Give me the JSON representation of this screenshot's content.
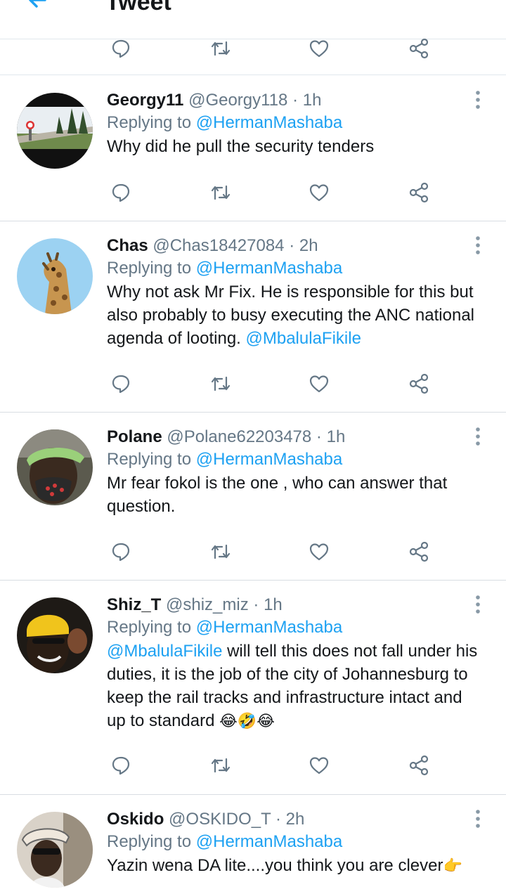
{
  "header": {
    "title": "Tweet"
  },
  "tweets": [
    {
      "name": "Georgy11",
      "handle": "@Georgy118",
      "time": "1h",
      "reply_prefix": "Replying to",
      "reply_to": "@HermanMashaba",
      "text": "Why did he pull the security tenders"
    },
    {
      "name": "Chas",
      "handle": "@Chas18427084",
      "time": "2h",
      "reply_prefix": "Replying to",
      "reply_to": "@HermanMashaba",
      "text": "Why not ask Mr Fix. He is responsible for this but also probably to busy executing the ANC national agenda of looting.",
      "mention": "@MbalulaFikile"
    },
    {
      "name": "Polane",
      "handle": "@Polane62203478",
      "time": "1h",
      "reply_prefix": "Replying to",
      "reply_to": "@HermanMashaba",
      "text": "Mr fear fokol is the one , who can answer that question."
    },
    {
      "name": "Shiz_T",
      "handle": "@shiz_miz",
      "time": "1h",
      "reply_prefix": "Replying to",
      "reply_to": "@HermanMashaba",
      "mention": "@MbalulaFikile",
      "text": "will tell this does not fall under his duties, it is the job of the city of Johannesburg to keep the rail tracks and infrastructure intact and up to standard",
      "emoji": "😂🤣😂"
    },
    {
      "name": "Oskido",
      "handle": "@OSKIDO_T",
      "time": "2h",
      "reply_prefix": "Replying to",
      "reply_to": "@HermanMashaba",
      "text": "Yazin wena DA lite....you think you are clever",
      "emoji": "👉"
    }
  ],
  "separator": "·",
  "icons": {
    "back": "arrow-left-icon",
    "reply": "reply-bubble-icon",
    "retweet": "retweet-icon",
    "like": "heart-icon",
    "share": "share-icon",
    "more": "more-vertical-icon"
  },
  "colors": {
    "accent": "#1da1f2",
    "secondary_text": "#657786",
    "divider": "#e1e8ed"
  }
}
